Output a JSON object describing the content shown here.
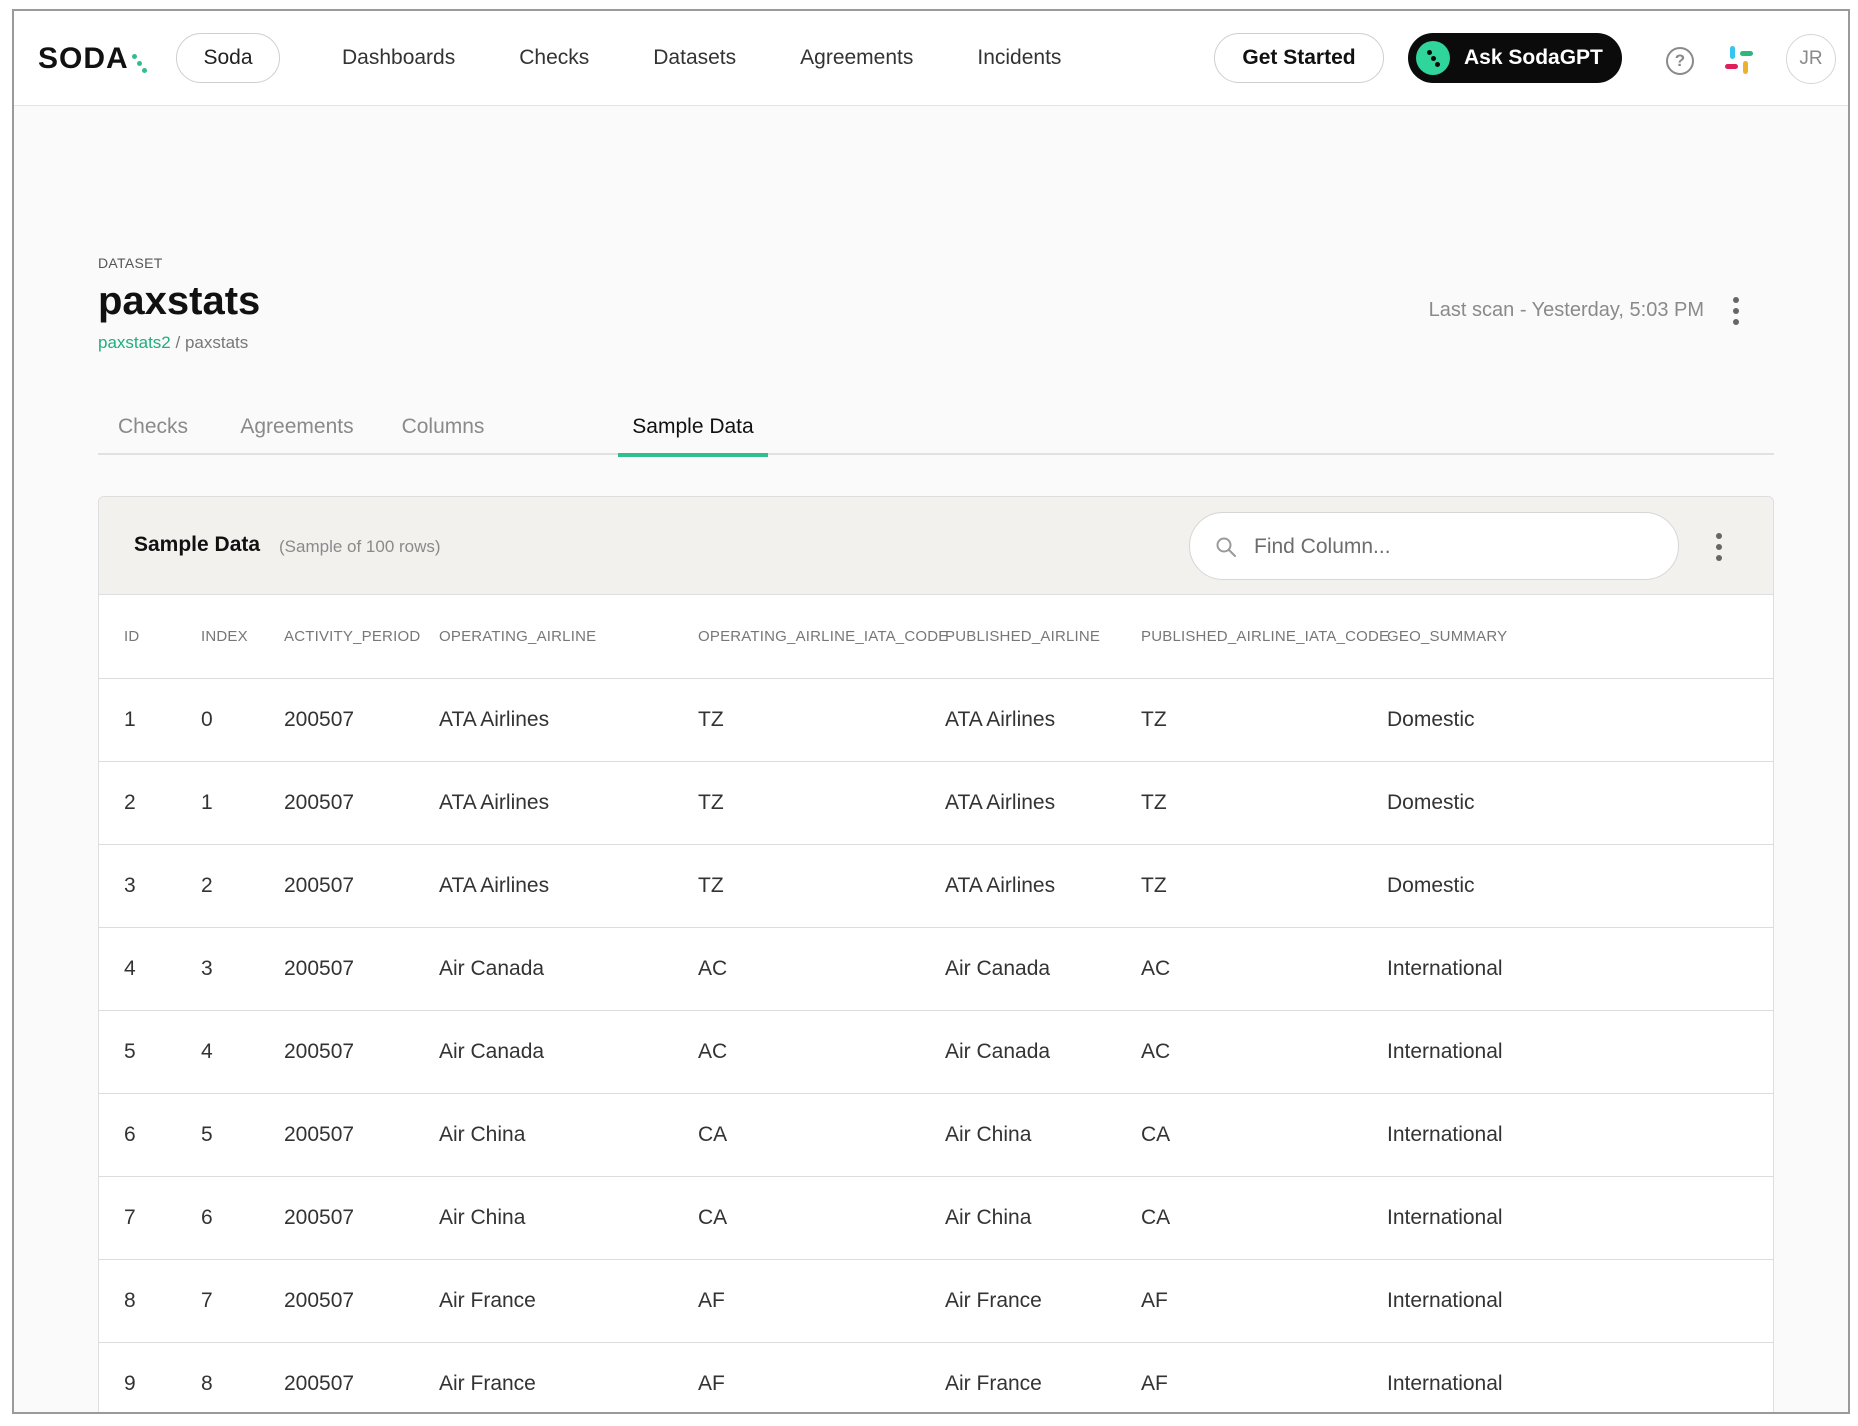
{
  "nav": {
    "logo": "SODA",
    "org": "Soda",
    "items": [
      "Dashboards",
      "Checks",
      "Datasets",
      "Agreements",
      "Incidents"
    ],
    "get_started": "Get Started",
    "ask_gpt": "Ask SodaGPT",
    "avatar": "JR",
    "help": "?"
  },
  "header": {
    "eyebrow": "DATASET",
    "title": "paxstats",
    "breadcrumb_link": "paxstats2",
    "breadcrumb_sep": " / ",
    "breadcrumb_current": "paxstats",
    "last_scan": "Last scan - Yesterday, 5:03 PM"
  },
  "tabs": [
    "Checks",
    "Agreements",
    "Columns",
    "Sample Data"
  ],
  "active_tab": "Sample Data",
  "sample": {
    "title": "Sample Data",
    "subtitle": "(Sample of 100 rows)",
    "search_placeholder": "Find Column..."
  },
  "table": {
    "columns": [
      "ID",
      "INDEX",
      "ACTIVITY_PERIOD",
      "OPERATING_AIRLINE",
      "OPERATING_AIRLINE_IATA_CODE",
      "PUBLISHED_AIRLINE",
      "PUBLISHED_AIRLINE_IATA_CODE",
      "GEO_SUMMARY"
    ],
    "rows": [
      [
        "1",
        "0",
        "200507",
        "ATA Airlines",
        "TZ",
        "ATA Airlines",
        "TZ",
        "Domestic"
      ],
      [
        "2",
        "1",
        "200507",
        "ATA Airlines",
        "TZ",
        "ATA Airlines",
        "TZ",
        "Domestic"
      ],
      [
        "3",
        "2",
        "200507",
        "ATA Airlines",
        "TZ",
        "ATA Airlines",
        "TZ",
        "Domestic"
      ],
      [
        "4",
        "3",
        "200507",
        "Air Canada",
        "AC",
        "Air Canada",
        "AC",
        "International"
      ],
      [
        "5",
        "4",
        "200507",
        "Air Canada",
        "AC",
        "Air Canada",
        "AC",
        "International"
      ],
      [
        "6",
        "5",
        "200507",
        "Air China",
        "CA",
        "Air China",
        "CA",
        "International"
      ],
      [
        "7",
        "6",
        "200507",
        "Air China",
        "CA",
        "Air China",
        "CA",
        "International"
      ],
      [
        "8",
        "7",
        "200507",
        "Air France",
        "AF",
        "Air France",
        "AF",
        "International"
      ],
      [
        "9",
        "8",
        "200507",
        "Air France",
        "AF",
        "Air France",
        "AF",
        "International"
      ]
    ]
  },
  "colors": {
    "accent": "#2fbf8d",
    "link": "#1fae7e",
    "gpt_button": "#0b0b0b",
    "card_header": "#f2f1ee"
  },
  "icons": [
    "soda-logo",
    "sodagpt-icon",
    "help-icon",
    "slack-icon",
    "kebab-menu-icon",
    "search-icon"
  ]
}
